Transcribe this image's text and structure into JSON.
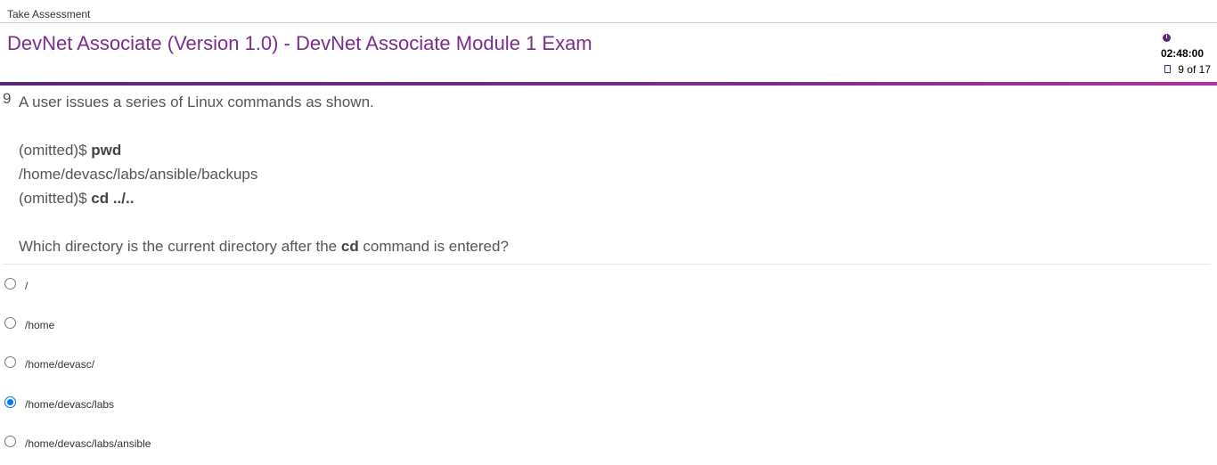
{
  "header": {
    "breadcrumb": "Take Assessment",
    "title": "DevNet Associate (Version 1.0) - DevNet Associate Module 1 Exam",
    "timer": "02:48:00",
    "progress": "9 of 17"
  },
  "question": {
    "number": "9",
    "intro": "A user issues a series of Linux commands as shown.",
    "line1_prefix": "(omitted)$ ",
    "line1_cmd": "pwd",
    "line2": "/home/devasc/labs/ansible/backups",
    "line3_prefix": "(omitted)$ ",
    "line3_cmd": "cd ../..",
    "prompt_before": "Which directory is the current directory after the ",
    "prompt_cmd": "cd",
    "prompt_after": " command is entered?"
  },
  "options": [
    {
      "label": "/",
      "selected": false
    },
    {
      "label": "/home",
      "selected": false
    },
    {
      "label": "/home/devasc/",
      "selected": false
    },
    {
      "label": "/home/devasc/labs",
      "selected": true
    },
    {
      "label": "/home/devasc/labs/ansible",
      "selected": false
    }
  ],
  "colors": {
    "title": "#7b2d8e",
    "accent_bar": "#5a2874",
    "radio_selected": "#0075ff"
  },
  "icons": {
    "timer": "clock-icon",
    "progress": "document-icon"
  }
}
